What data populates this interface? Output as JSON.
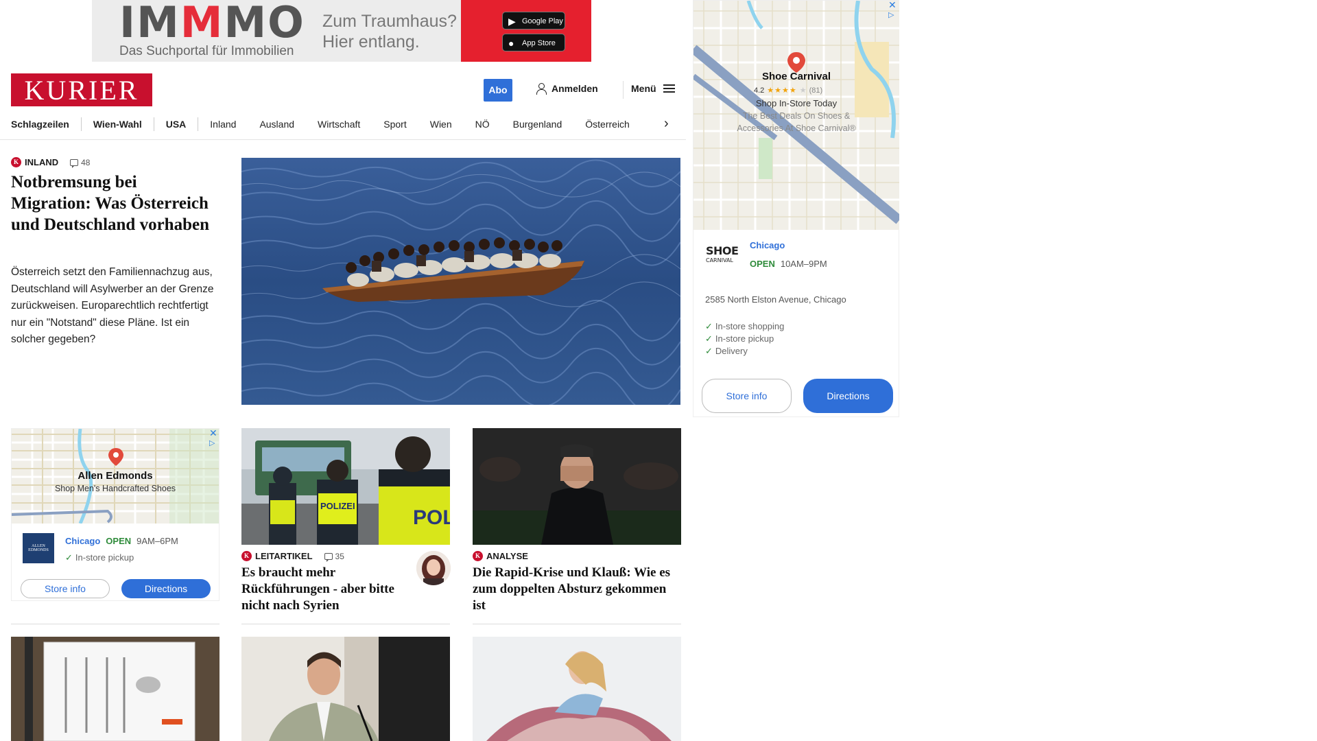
{
  "top_ad": {
    "brand_part1": "IM",
    "brand_part2": "M",
    "brand_part3": "MO",
    "subtitle": "Das Suchportal für Immobilien",
    "slogan_line1": "Zum Traumhaus?",
    "slogan_line2": "Hier entlang.",
    "google_play": "Google Play",
    "app_store": "App Store"
  },
  "header": {
    "logo": "KURIER",
    "abo": "Abo",
    "login": "Anmelden",
    "menu": "Menü"
  },
  "nav": {
    "items": [
      "Schlagzeilen",
      "Wien-Wahl",
      "USA",
      "Inland",
      "Ausland",
      "Wirtschaft",
      "Sport",
      "Wien",
      "NÖ",
      "Burgenland",
      "Österreich"
    ]
  },
  "lead": {
    "kicker": "INLAND",
    "comments": "48",
    "title": "Notbremsung bei Migration: Was Österreich und Deutschland vorhaben",
    "teaser": "Österreich setzt den Familiennachzug aus, Deutschland will Asylwerber an der Grenze zurückweisen. Europarechtlich rechtfertigt nur ein \"Notstand\" diese Pläne. Ist ein solcher gegeben?"
  },
  "small_ad": {
    "pin_title": "Allen Edmonds",
    "pin_sub": "Shop Men's Handcrafted Shoes",
    "logo_text": "ALLEN EDMONDS",
    "city": "Chicago",
    "open": "OPEN",
    "hours": "9AM–6PM",
    "feature": "In-store pickup",
    "store_info": "Store info",
    "directions": "Directions"
  },
  "cards": [
    {
      "kicker": "LEITARTIKEL",
      "comments": "35",
      "title": "Es braucht mehr Rückführungen - aber bitte nicht nach Syrien"
    },
    {
      "kicker": "ANALYSE",
      "title": "Die Rapid-Krise und Klauß: Wie es zum doppelten Absturz gekommen ist"
    }
  ],
  "police_vest": "POLIZEI",
  "police_vest2": "POLI",
  "right_ad": {
    "pin_title": "Shoe Carnival",
    "rating": "4.2",
    "reviews": "(81)",
    "line1": "Shop In-Store Today",
    "line2": "The Best Deals On Shoes &",
    "line3": "Accessories At Shoe Carnival®",
    "logo_main": "SHOE",
    "logo_sub": "CARNIVAL",
    "city": "Chicago",
    "open": "OPEN",
    "hours": "10AM–9PM",
    "address": "2585 North Elston Avenue, Chicago",
    "features": [
      "In-store shopping",
      "In-store pickup",
      "Delivery"
    ],
    "store_info": "Store info",
    "directions": "Directions"
  },
  "colors": {
    "kurier_red": "#c8102e",
    "link_blue": "#2f6fd8",
    "open_green": "#2e8b3a"
  }
}
